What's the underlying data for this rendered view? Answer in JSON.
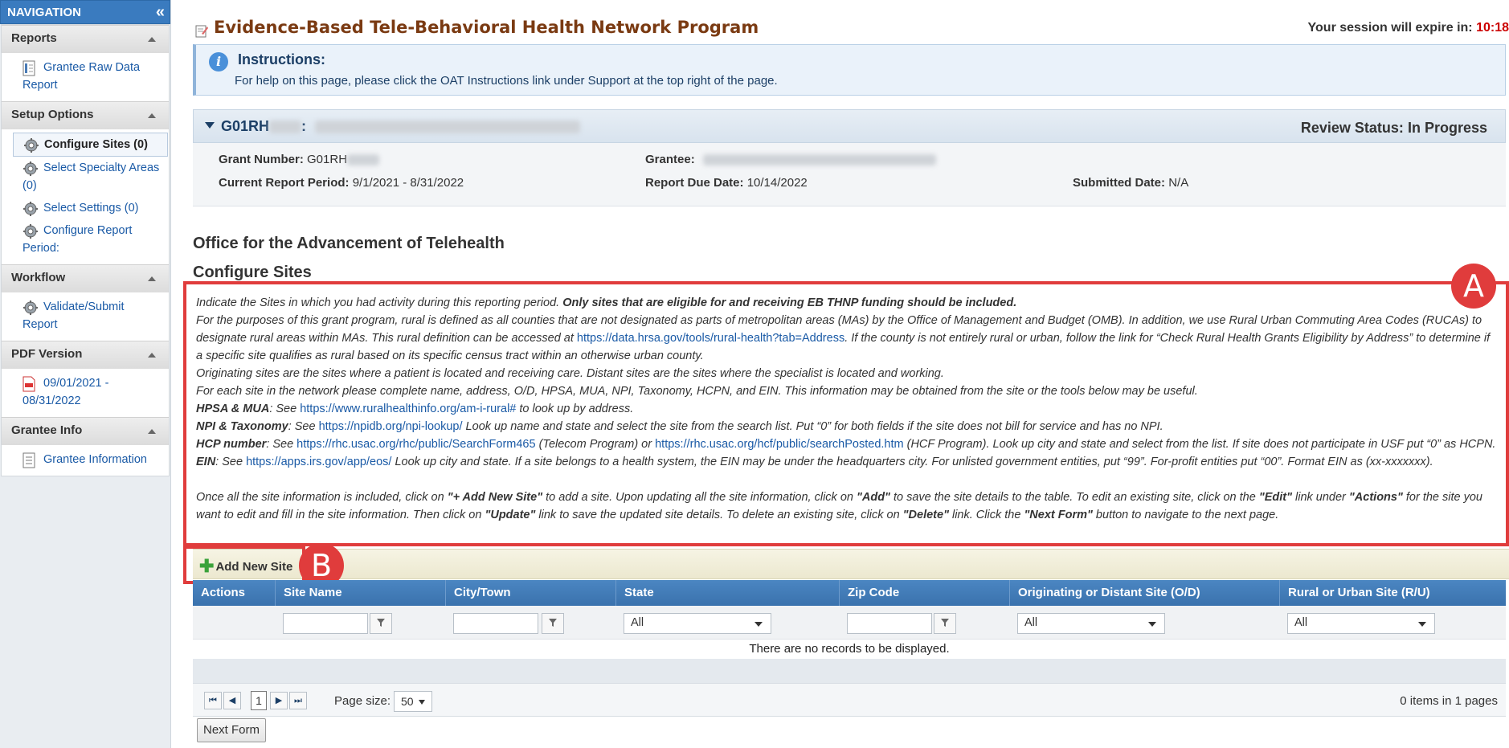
{
  "sidebar": {
    "header": "NAVIGATION",
    "sections": [
      {
        "title": "Reports",
        "items": [
          {
            "label": "Grantee Raw Data Report",
            "icon": "report-icon"
          }
        ]
      },
      {
        "title": "Setup Options",
        "items": [
          {
            "label": "Configure Sites (0)",
            "icon": "gear-icon",
            "active": true
          },
          {
            "label": "Select Specialty Areas (0)",
            "icon": "gear-icon"
          },
          {
            "label": "Select Settings (0)",
            "icon": "gear-icon"
          },
          {
            "label": "Configure Report Period:",
            "icon": "gear-icon"
          }
        ]
      },
      {
        "title": "Workflow",
        "items": [
          {
            "label": "Validate/Submit Report",
            "icon": "gear-icon"
          }
        ]
      },
      {
        "title": "PDF Version",
        "items": [
          {
            "label": "09/01/2021 - 08/31/2022",
            "icon": "pdf-icon"
          }
        ]
      },
      {
        "title": "Grantee Info",
        "items": [
          {
            "label": "Grantee Information",
            "icon": "document-icon"
          }
        ]
      }
    ]
  },
  "header": {
    "title": "Evidence-Based Tele-Behavioral Health Network Program",
    "session_label": "Your session will expire in:",
    "session_time": "10:18"
  },
  "instructions": {
    "title": "Instructions:",
    "text": "For help on this page, please click the OAT Instructions link under Support at the top right of the page."
  },
  "grant": {
    "id": "G01RH",
    "review_label": "Review Status:",
    "review_value": "In Progress",
    "grant_number_label": "Grant Number:",
    "grant_number_value": "G01RH",
    "grantee_label": "Grantee:",
    "period_label": "Current Report Period:",
    "period_value": "9/1/2021 - 8/31/2022",
    "due_label": "Report Due Date:",
    "due_value": "10/14/2022",
    "submitted_label": "Submitted Date:",
    "submitted_value": "N/A"
  },
  "section": {
    "office_title": "Office for the Advancement of Telehealth",
    "page_subtitle": "Configure Sites"
  },
  "guidance": {
    "p1a": "Indicate the Sites in which you had activity during this reporting period. ",
    "p1b": "Only sites that are eligible for and receiving EB THNP funding should be included.",
    "p2a": "For the purposes of this grant program, rural is defined as all counties that are not designated as parts of metropolitan areas (MAs) by the Office of Management and Budget (OMB). In addition, we use Rural Urban Commuting Area Codes (RUCAs) to designate rural areas within MAs. This rural definition can be accessed at ",
    "p2link": "https://data.hrsa.gov/tools/rural-health?tab=Address",
    "p2b": ". If the county is not entirely rural or urban, follow the link for “Check Rural Health Grants Eligibility by Address” to determine if a specific site qualifies as rural based on its specific census tract within an otherwise urban county.",
    "p3": "Originating sites are the sites where a patient is located and receiving care. Distant sites are the sites where the specialist is located and working.",
    "p4": "For each site in the network please complete name, address, O/D, HPSA, MUA, NPI, Taxonomy, HCPN, and EIN. This information may be obtained from the site or the tools below may be useful.",
    "hpsa_label": "HPSA & MUA",
    "hpsa_pre": ": See ",
    "hpsa_link": "https://www.ruralhealthinfo.org/am-i-rural#",
    "hpsa_post": " to look up by address.",
    "npi_label": "NPI & Taxonomy",
    "npi_pre": ": See ",
    "npi_link": "https://npidb.org/npi-lookup/",
    "npi_post": " Look up name and state and select the site from the search list. Put “0” for both fields if the site does not bill for service and has no NPI.",
    "hcp_label": "HCP number",
    "hcp_pre": ": See ",
    "hcp_link1": "https://rhc.usac.org/rhc/public/SearchForm465",
    "hcp_mid": " (Telecom Program) or ",
    "hcp_link2": "https://rhc.usac.org/hcf/public/searchPosted.htm",
    "hcp_post": " (HCF Program). Look up city and state and select from the list. If site does not participate in USF put “0” as HCPN.",
    "ein_label": "EIN",
    "ein_pre": ": See ",
    "ein_link": "https://apps.irs.gov/app/eos/",
    "ein_post": " Look up city and state. If a site belongs to a health system, the EIN may be under the headquarters city. For unlisted government entities, put “99”. For-profit entities put “00”. Format EIN as (xx-xxxxxxx).",
    "p5a": "Once all the site information is included, click on ",
    "p5b": "\"+ Add New Site\"",
    "p5c": " to add a site. Upon updating all the site information, click on ",
    "p5d": "\"Add\"",
    "p5e": " to save the site details to the table. To edit an existing site, click on the ",
    "p5f": "\"Edit\"",
    "p5g": " link under ",
    "p5h": "\"Actions\"",
    "p5i": " for the site you want to edit and fill in the site information. Then click on ",
    "p5j": "\"Update\"",
    "p5k": " link to save the updated site details. To delete an existing site, click on ",
    "p5l": "\"Delete\"",
    "p5m": " link. Click the ",
    "p5n": "\"Next Form\"",
    "p5o": " button to navigate to the next page."
  },
  "callouts": {
    "a": "A",
    "b": "B"
  },
  "toolbar": {
    "add_label": "Add New Site"
  },
  "grid": {
    "columns": [
      "Actions",
      "Site Name",
      "City/Town",
      "State",
      "Zip Code",
      "Originating or Distant Site (O/D)",
      "Rural or Urban Site (R/U)"
    ],
    "filter_all": "All",
    "empty_text": "There are no records to be displayed."
  },
  "pager": {
    "current_page": "1",
    "page_size_label": "Page size:",
    "page_size": "50",
    "info": "0 items in 1 pages"
  },
  "footer": {
    "next_label": "Next Form"
  },
  "colors": {
    "accent": "#3a7bbf",
    "title": "#7a3a12",
    "callout": "#e03c3c",
    "timer": "#cc0000"
  }
}
